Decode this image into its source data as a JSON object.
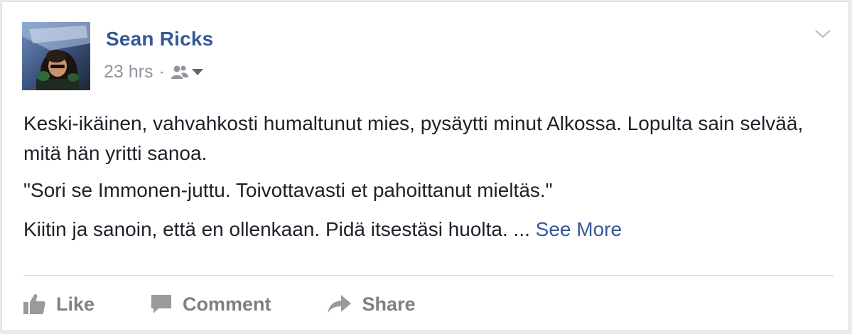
{
  "post": {
    "author": "Sean Ricks",
    "timestamp": "23 hrs",
    "separator": "·",
    "audience_icon": "friends-icon",
    "menu_icon": "chevron-down-icon",
    "paragraphs": [
      "Keski-ikäinen, vahvahkosti humaltunut mies, pysäytti minut Alkossa. Lopulta sain selvää, mitä hän yritti sanoa.",
      "\"Sori se Immonen-juttu. Toivottavasti et pahoittanut mieltäs.\"",
      "Kiitin ja sanoin, että en ollenkaan. Pidä itsestäsi huolta. ..."
    ],
    "see_more": "See More"
  },
  "actions": {
    "like_label": "Like",
    "comment_label": "Comment",
    "share_label": "Share"
  },
  "colors": {
    "author": "#365899",
    "meta": "#90949c",
    "text": "#1d2129",
    "action": "#7f7f7f"
  }
}
